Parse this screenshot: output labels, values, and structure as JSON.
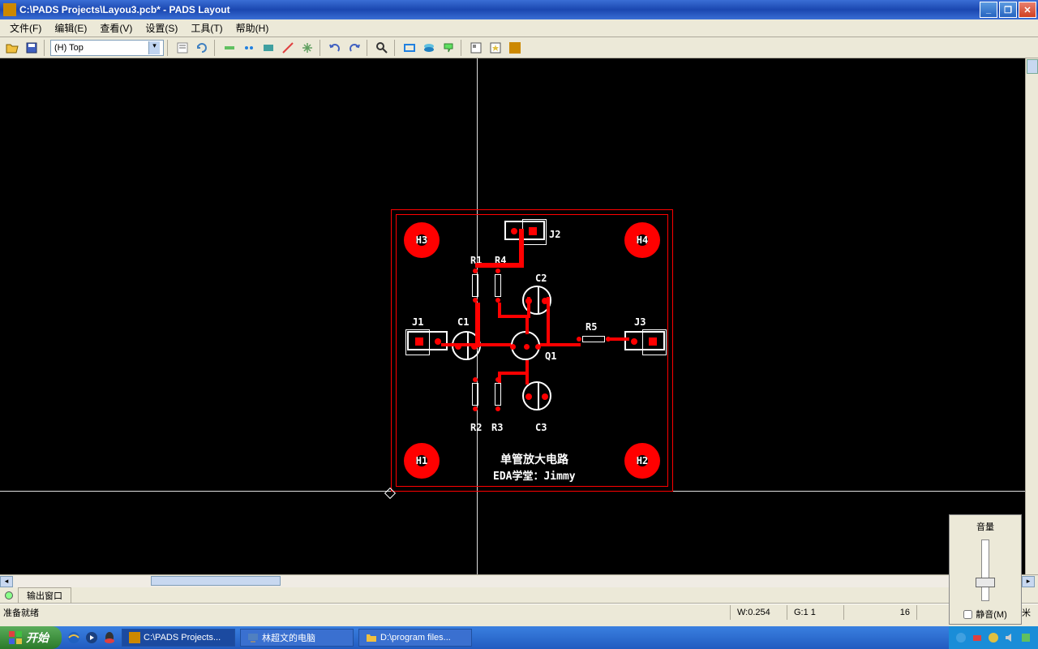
{
  "window": {
    "title": "C:\\PADS Projects\\Layou3.pcb* - PADS Layout"
  },
  "menu": {
    "file": "文件(F)",
    "edit": "编辑(E)",
    "view": "查看(V)",
    "setup": "设置(S)",
    "tools": "工具(T)",
    "help": "帮助(H)"
  },
  "toolbar": {
    "layer_selected": "(H) Top"
  },
  "pcb": {
    "holes": {
      "h1": "H1",
      "h2": "H2",
      "h3": "H3",
      "h4": "H4"
    },
    "conns": {
      "j1": "J1",
      "j2": "J2",
      "j3": "J3"
    },
    "res": {
      "r1": "R1",
      "r2": "R2",
      "r3": "R3",
      "r4": "R4",
      "r5": "R5"
    },
    "caps": {
      "c1": "C1",
      "c2": "C2",
      "c3": "C3"
    },
    "trans": {
      "q1": "Q1"
    },
    "silk_line1": "单管放大电路",
    "silk_line2": "EDA学堂：Jimmy"
  },
  "output": {
    "tab": "输出窗口"
  },
  "status": {
    "ready": "准备就绪",
    "w": "W:0.254",
    "g": "G:1 1",
    "coord": "16",
    "unit": "毫米"
  },
  "taskbar": {
    "start": "开始",
    "t1": "C:\\PADS Projects...",
    "t2": "林超文的电脑",
    "t3": "D:\\program files..."
  },
  "volume": {
    "title": "音量",
    "mute": "静音(M)"
  }
}
